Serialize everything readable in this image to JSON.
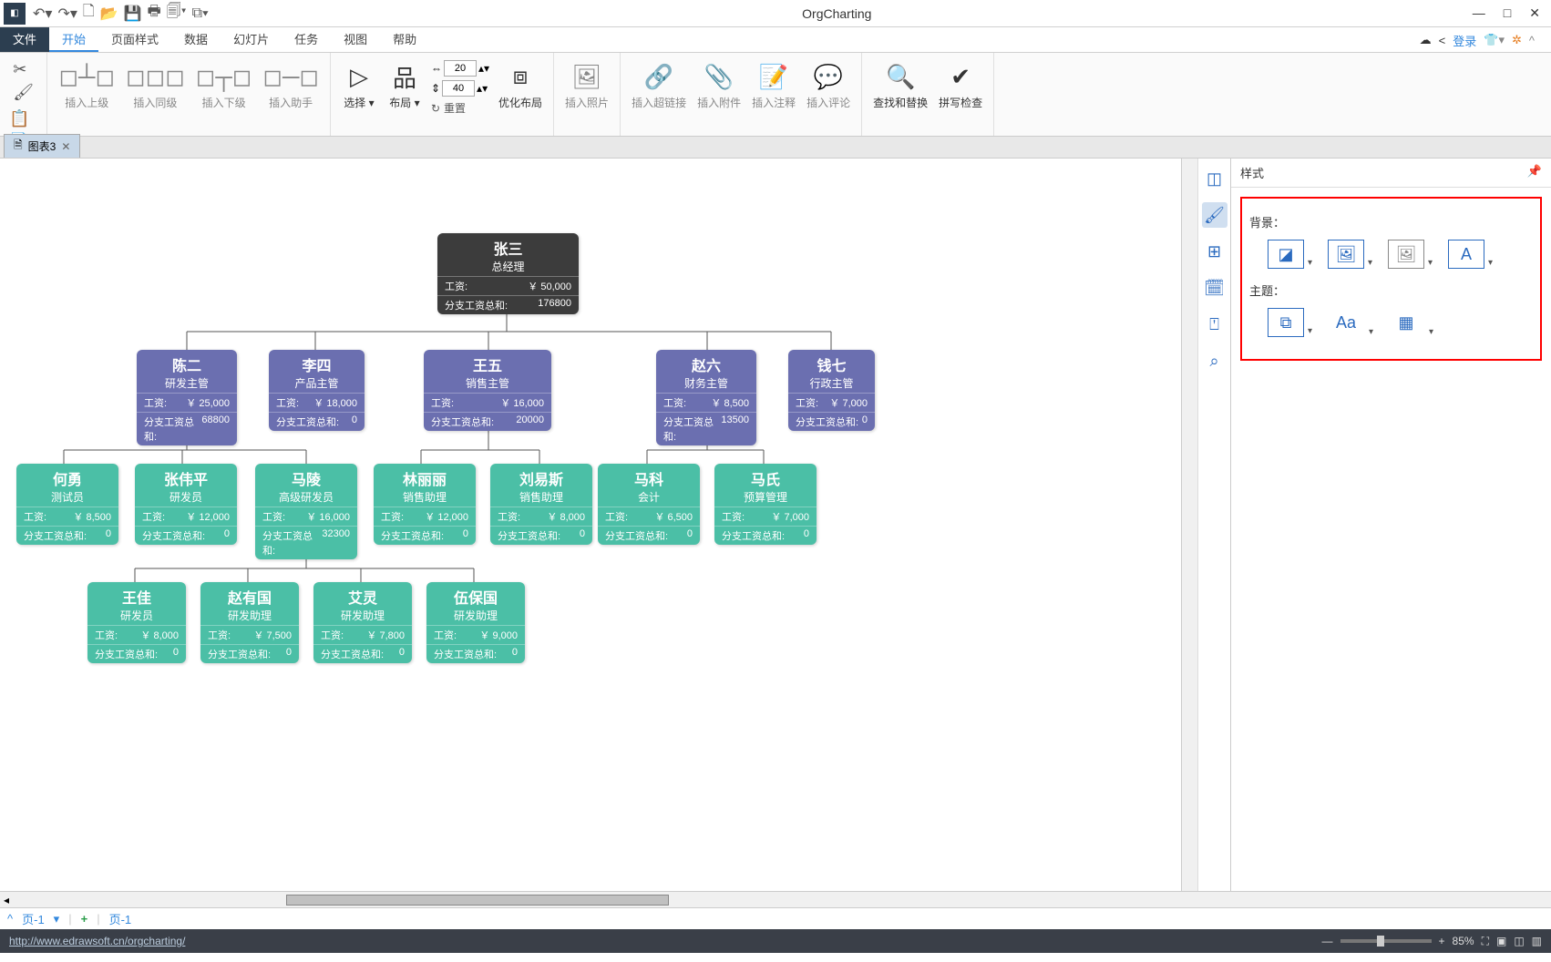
{
  "app_title": "OrgCharting",
  "login_label": "登录",
  "menu": {
    "file": "文件",
    "start": "开始",
    "page": "页面样式",
    "data": "数据",
    "slides": "幻灯片",
    "task": "任务",
    "view": "视图",
    "help": "帮助"
  },
  "ribbon": {
    "insert_parent": "插入上级",
    "insert_sibling": "插入同级",
    "insert_child": "插入下级",
    "insert_assistant": "插入助手",
    "select": "选择",
    "layout": "布局",
    "reset": "重置",
    "optimize": "优化布局",
    "insert_photo": "插入照片",
    "insert_link": "插入超链接",
    "insert_attach": "插入附件",
    "insert_note": "插入注释",
    "insert_comment": "插入评论",
    "find_replace": "查找和替换",
    "spell": "拼写检查",
    "spin1": "20",
    "spin2": "40"
  },
  "doc_tab": "图表3",
  "right_panel": {
    "title": "样式",
    "bg": "背景：",
    "theme": "主题："
  },
  "salary_label": "工资:",
  "branch_label": "分支工资总和:",
  "nodes": {
    "root": {
      "name": "张三",
      "title": "总经理",
      "salary": "￥ 50,000",
      "branch": "176800"
    },
    "l1": [
      {
        "name": "陈二",
        "title": "研发主管",
        "salary": "￥ 25,000",
        "branch": "68800"
      },
      {
        "name": "李四",
        "title": "产品主管",
        "salary": "￥ 18,000",
        "branch": "0"
      },
      {
        "name": "王五",
        "title": "销售主管",
        "salary": "￥ 16,000",
        "branch": "20000"
      },
      {
        "name": "赵六",
        "title": "财务主管",
        "salary": "￥ 8,500",
        "branch": "13500"
      },
      {
        "name": "钱七",
        "title": "行政主管",
        "salary": "￥ 7,000",
        "branch": "0"
      }
    ],
    "l2a": [
      {
        "name": "何勇",
        "title": "测试员",
        "salary": "￥ 8,500",
        "branch": "0"
      },
      {
        "name": "张伟平",
        "title": "研发员",
        "salary": "￥ 12,000",
        "branch": "0"
      },
      {
        "name": "马陵",
        "title": "高级研发员",
        "salary": "￥ 16,000",
        "branch": "32300"
      }
    ],
    "l2b": [
      {
        "name": "林丽丽",
        "title": "销售助理",
        "salary": "￥ 12,000",
        "branch": "0"
      },
      {
        "name": "刘易斯",
        "title": "销售助理",
        "salary": "￥ 8,000",
        "branch": "0"
      }
    ],
    "l2c": [
      {
        "name": "马科",
        "title": "会计",
        "salary": "￥ 6,500",
        "branch": "0"
      },
      {
        "name": "马氏",
        "title": "预算管理",
        "salary": "￥ 7,000",
        "branch": "0"
      }
    ],
    "l3": [
      {
        "name": "王佳",
        "title": "研发员",
        "salary": "￥ 8,000",
        "branch": "0"
      },
      {
        "name": "赵有国",
        "title": "研发助理",
        "salary": "￥ 7,500",
        "branch": "0"
      },
      {
        "name": "艾灵",
        "title": "研发助理",
        "salary": "￥ 7,800",
        "branch": "0"
      },
      {
        "name": "伍保国",
        "title": "研发助理",
        "salary": "￥ 9,000",
        "branch": "0"
      }
    ]
  },
  "page_nav": {
    "left": "页-1",
    "right": "页-1"
  },
  "status_url": "http://www.edrawsoft.cn/orgcharting/",
  "zoom": "85%"
}
